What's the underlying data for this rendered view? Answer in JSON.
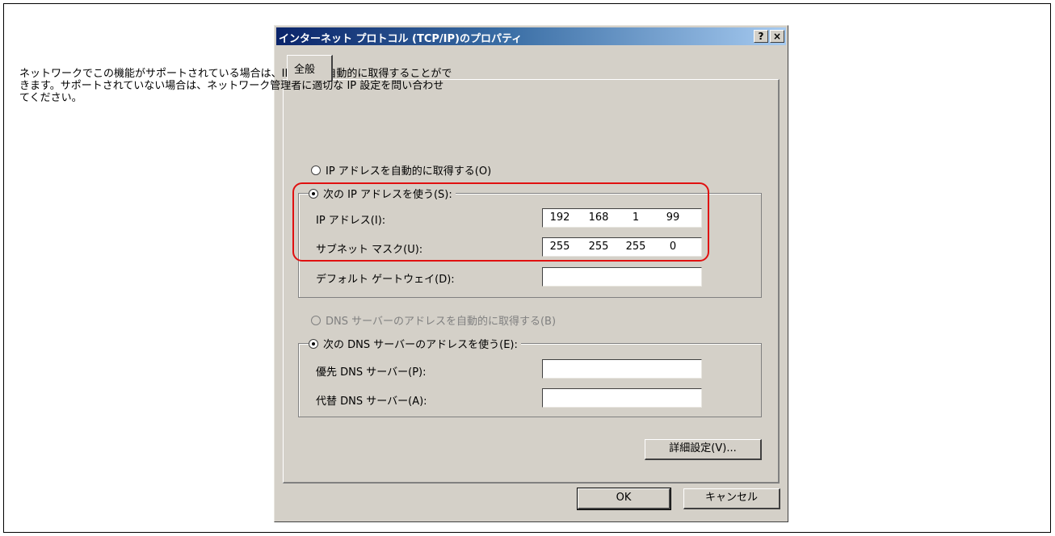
{
  "dialog": {
    "title": "インターネット プロトコル (TCP/IP)のプロパティ",
    "help_button": "?",
    "close_button": "×",
    "tab_label": "全般",
    "description_lines": [
      "ネットワークでこの機能がサポートされている場合は、IP 設定を自動的に取得することがで",
      "きます。サポートされていない場合は、ネットワーク管理者に適切な IP 設定を問い合わせ",
      "てください。"
    ]
  },
  "ip": {
    "auto_label": "IP アドレスを自動的に取得する(O)",
    "manual_label": "次の IP アドレスを使う(S):",
    "selected": "manual",
    "address_label": "IP アドレス(I):",
    "address_octets": [
      "192",
      "168",
      "1",
      "99"
    ],
    "subnet_label": "サブネット マスク(U):",
    "subnet_octets": [
      "255",
      "255",
      "255",
      "0"
    ],
    "gateway_label": "デフォルト ゲートウェイ(D):",
    "gateway_octets": [
      "",
      "",
      "",
      ""
    ]
  },
  "dns": {
    "auto_label": "DNS サーバーのアドレスを自動的に取得する(B)",
    "manual_label": "次の DNS サーバーのアドレスを使う(E):",
    "selected": "manual",
    "preferred_label": "優先 DNS サーバー(P):",
    "alternate_label": "代替 DNS サーバー(A):"
  },
  "buttons": {
    "advanced": "詳細設定(V)...",
    "ok": "OK",
    "cancel": "キャンセル"
  },
  "colors": {
    "highlight": "#e01010",
    "dialog_bg": "#d4d0c8",
    "title_start": "#0a246a"
  }
}
